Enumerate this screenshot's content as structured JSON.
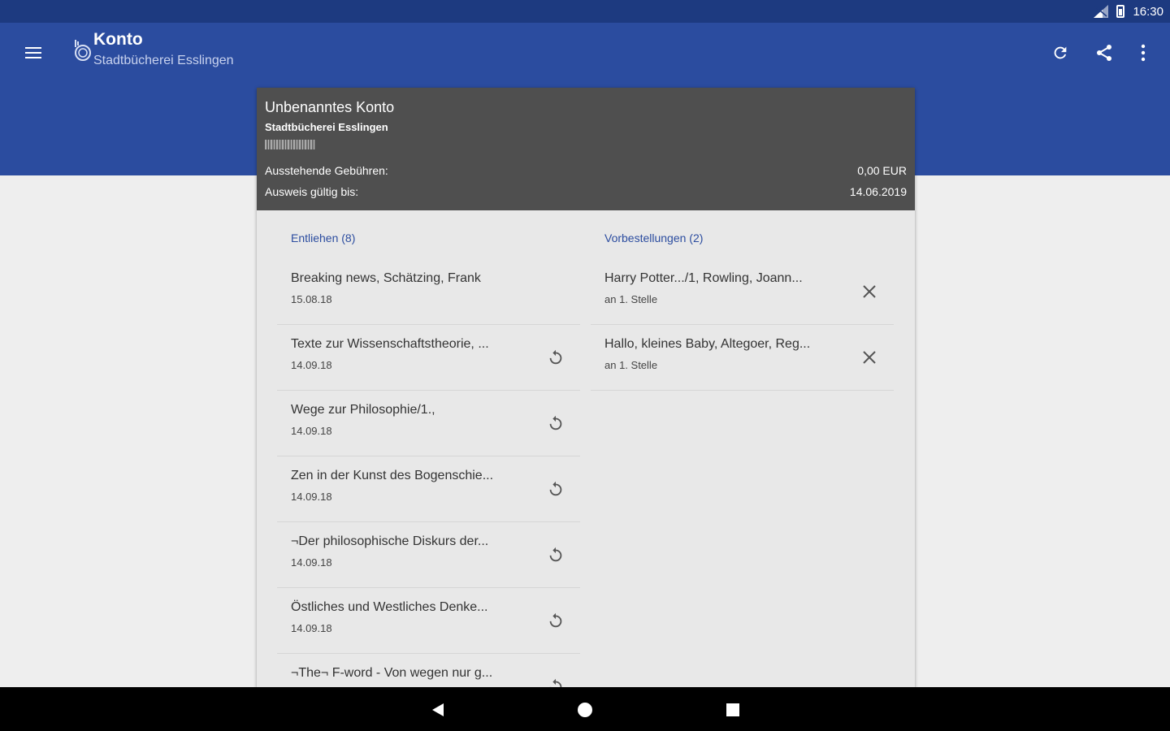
{
  "status_bar": {
    "time": "16:30",
    "icons": [
      "signal-icon",
      "battery-icon"
    ]
  },
  "app_bar": {
    "title": "Konto",
    "subtitle": "Stadtbücherei Esslingen",
    "icons": [
      "menu-icon",
      "library-logo-icon",
      "refresh-icon",
      "share-icon",
      "more-vert-icon"
    ]
  },
  "account": {
    "name": "Unbenanntes Konto",
    "library": "Stadtbücherei Esslingen",
    "fees_label": "Ausstehende Gebühren:",
    "fees_value": "0,00 EUR",
    "valid_label": "Ausweis gültig bis:",
    "valid_value": "14.06.2019"
  },
  "lent": {
    "title": "Entliehen (8)",
    "items": [
      {
        "title": "Breaking news, Schätzing, Frank",
        "date": "15.08.18",
        "renewable": false
      },
      {
        "title": "Texte zur Wissenschaftstheorie, ...",
        "date": "14.09.18",
        "renewable": true
      },
      {
        "title": "Wege zur Philosophie/1.,",
        "date": "14.09.18",
        "renewable": true
      },
      {
        "title": "Zen in der Kunst des Bogenschie...",
        "date": "14.09.18",
        "renewable": true
      },
      {
        "title": "¬Der philosophische Diskurs der...",
        "date": "14.09.18",
        "renewable": true
      },
      {
        "title": "Östliches und Westliches Denke...",
        "date": "14.09.18",
        "renewable": true
      },
      {
        "title": "¬The¬ F-word - Von wegen nur g...",
        "date": "",
        "renewable": true
      }
    ]
  },
  "reservations": {
    "title": "Vorbestellungen (2)",
    "items": [
      {
        "title": "Harry Potter.../1, Rowling, Joann...",
        "position": "an 1. Stelle"
      },
      {
        "title": "Hallo, kleines Baby, Altegoer, Reg...",
        "position": "an 1. Stelle"
      }
    ]
  },
  "colors": {
    "primary": "#2b4c9f",
    "status_bar": "#1d3a80",
    "header": "#4f4f4f",
    "background": "#eeeeee",
    "card": "#e8e8e8"
  },
  "navigation_bar": {
    "icons": [
      "back-icon",
      "home-icon",
      "recents-icon"
    ]
  }
}
